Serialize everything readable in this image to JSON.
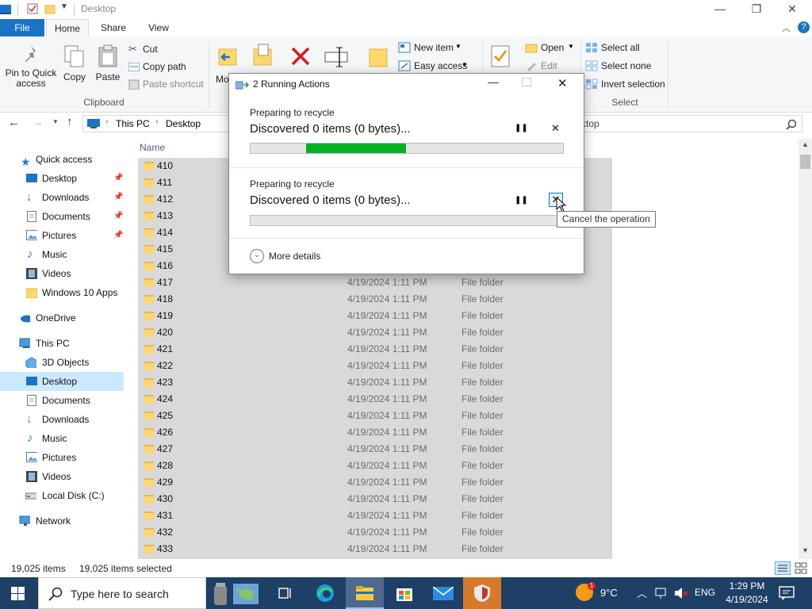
{
  "window": {
    "title": "Desktop"
  },
  "window_controls": {
    "minimize": "—",
    "restore": "❐",
    "close": "✕"
  },
  "ribbon_tabs": [
    "File",
    "Home",
    "Share",
    "View"
  ],
  "ribbon": {
    "pin_label": "Pin to Quick access",
    "copy_label": "Copy",
    "paste_label": "Paste",
    "cut_label": "Cut",
    "copy_path_label": "Copy path",
    "paste_shortcut_label": "Paste shortcut",
    "clipboard_group": "Clipboard",
    "move_to_label": "Mo to",
    "new_item_label": "New item",
    "easy_access_label": "Easy access",
    "open_label": "Open",
    "edit_label": "Edit",
    "select_all_label": "Select all",
    "select_none_label": "Select none",
    "invert_selection_label": "Invert selection",
    "select_group": "Select"
  },
  "address": {
    "this_pc": "This PC",
    "desktop": "Desktop",
    "search_partial": "ktop"
  },
  "nav": {
    "quick_access": "Quick access",
    "quick_items": [
      "Desktop",
      "Downloads",
      "Documents",
      "Pictures",
      "Music",
      "Videos",
      "Windows 10 Apps"
    ],
    "onedrive": "OneDrive",
    "this_pc": "This PC",
    "pc_items": [
      "3D Objects",
      "Desktop",
      "Documents",
      "Downloads",
      "Music",
      "Pictures",
      "Videos",
      "Local Disk (C:)"
    ],
    "network": "Network"
  },
  "list": {
    "header_name": "Name",
    "rows": [
      {
        "name": "410",
        "date": "",
        "type": ""
      },
      {
        "name": "411",
        "date": "",
        "type": ""
      },
      {
        "name": "412",
        "date": "",
        "type": ""
      },
      {
        "name": "413",
        "date": "",
        "type": ""
      },
      {
        "name": "414",
        "date": "",
        "type": ""
      },
      {
        "name": "415",
        "date": "",
        "type": ""
      },
      {
        "name": "416",
        "date": "",
        "type": ""
      },
      {
        "name": "417",
        "date": "4/19/2024 1:11 PM",
        "type": "File folder"
      },
      {
        "name": "418",
        "date": "4/19/2024 1:11 PM",
        "type": "File folder"
      },
      {
        "name": "419",
        "date": "4/19/2024 1:11 PM",
        "type": "File folder"
      },
      {
        "name": "420",
        "date": "4/19/2024 1:11 PM",
        "type": "File folder"
      },
      {
        "name": "421",
        "date": "4/19/2024 1:11 PM",
        "type": "File folder"
      },
      {
        "name": "422",
        "date": "4/19/2024 1:11 PM",
        "type": "File folder"
      },
      {
        "name": "423",
        "date": "4/19/2024 1:11 PM",
        "type": "File folder"
      },
      {
        "name": "424",
        "date": "4/19/2024 1:11 PM",
        "type": "File folder"
      },
      {
        "name": "425",
        "date": "4/19/2024 1:11 PM",
        "type": "File folder"
      },
      {
        "name": "426",
        "date": "4/19/2024 1:11 PM",
        "type": "File folder"
      },
      {
        "name": "427",
        "date": "4/19/2024 1:11 PM",
        "type": "File folder"
      },
      {
        "name": "428",
        "date": "4/19/2024 1:11 PM",
        "type": "File folder"
      },
      {
        "name": "429",
        "date": "4/19/2024 1:11 PM",
        "type": "File folder"
      },
      {
        "name": "430",
        "date": "4/19/2024 1:11 PM",
        "type": "File folder"
      },
      {
        "name": "431",
        "date": "4/19/2024 1:11 PM",
        "type": "File folder"
      },
      {
        "name": "432",
        "date": "4/19/2024 1:11 PM",
        "type": "File folder"
      },
      {
        "name": "433",
        "date": "4/19/2024 1:11 PM",
        "type": "File folder"
      }
    ]
  },
  "status": {
    "items": "19,025 items",
    "selected": "19,025 items selected"
  },
  "dialog": {
    "title": "2 Running Actions",
    "op1": {
      "small": "Preparing to recycle",
      "big": "Discovered 0 items (0 bytes)...",
      "progress": 0.32
    },
    "op2": {
      "small": "Preparing to recycle",
      "big": "Discovered 0 items (0 bytes)...",
      "progress": 0.0
    },
    "more_details": "More details",
    "tooltip": "Cancel the operation",
    "pause_glyph": "❚❚",
    "cancel_glyph": "✕"
  },
  "taskbar": {
    "search_placeholder": "Type here to search",
    "weather": "9°C",
    "lang": "ENG",
    "time": "1:29 PM",
    "date": "4/19/2024"
  },
  "colors": {
    "accent": "#1a73c7",
    "progress": "#06b025",
    "selection": "#d9d9d9",
    "taskbar": "#1e3f66"
  }
}
